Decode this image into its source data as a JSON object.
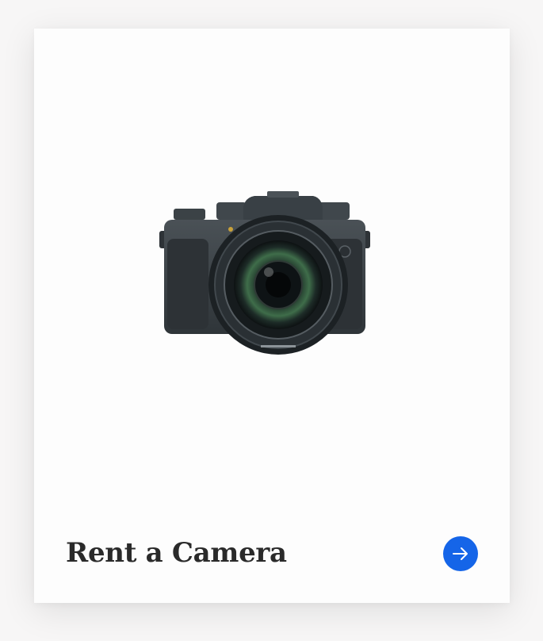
{
  "card": {
    "title": "Rent a Camera",
    "image_alt": "camera-photo",
    "action_icon": "arrow-right-icon"
  },
  "colors": {
    "page_background": "#f7f6f6",
    "card_background": "#fdfdfd",
    "title_text": "#2a2a2a",
    "accent": "#1565e8"
  }
}
